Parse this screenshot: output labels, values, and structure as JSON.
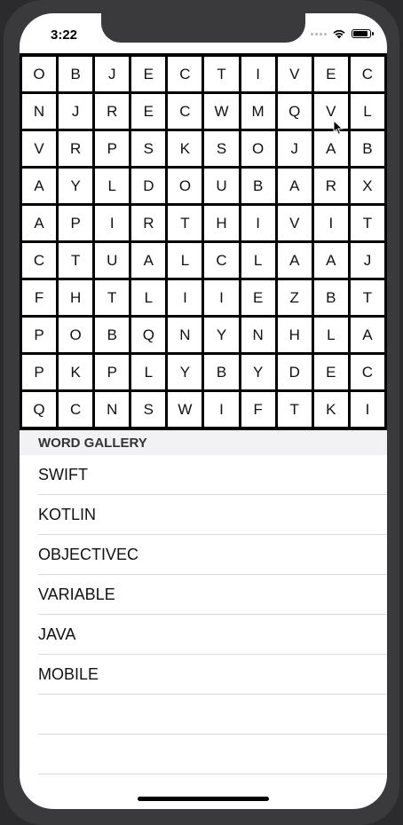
{
  "status_bar": {
    "time": "3:22"
  },
  "grid": [
    [
      "O",
      "B",
      "J",
      "E",
      "C",
      "T",
      "I",
      "V",
      "E",
      "C"
    ],
    [
      "N",
      "J",
      "R",
      "E",
      "C",
      "W",
      "M",
      "Q",
      "V",
      "L"
    ],
    [
      "V",
      "R",
      "P",
      "S",
      "K",
      "S",
      "O",
      "J",
      "A",
      "B"
    ],
    [
      "A",
      "Y",
      "L",
      "D",
      "O",
      "U",
      "B",
      "A",
      "R",
      "X"
    ],
    [
      "A",
      "P",
      "I",
      "R",
      "T",
      "H",
      "I",
      "V",
      "I",
      "T"
    ],
    [
      "C",
      "T",
      "U",
      "A",
      "L",
      "C",
      "L",
      "A",
      "A",
      "J"
    ],
    [
      "F",
      "H",
      "T",
      "L",
      "I",
      "I",
      "E",
      "Z",
      "B",
      "T"
    ],
    [
      "P",
      "O",
      "B",
      "Q",
      "N",
      "Y",
      "N",
      "H",
      "L",
      "A"
    ],
    [
      "P",
      "K",
      "P",
      "L",
      "Y",
      "B",
      "Y",
      "D",
      "E",
      "C"
    ],
    [
      "Q",
      "C",
      "N",
      "S",
      "W",
      "I",
      "F",
      "T",
      "K",
      "I"
    ]
  ],
  "word_gallery": {
    "header": "WORD GALLERY",
    "words": [
      "SWIFT",
      "KOTLIN",
      "OBJECTIVEC",
      "VARIABLE",
      "JAVA",
      "MOBILE"
    ]
  }
}
